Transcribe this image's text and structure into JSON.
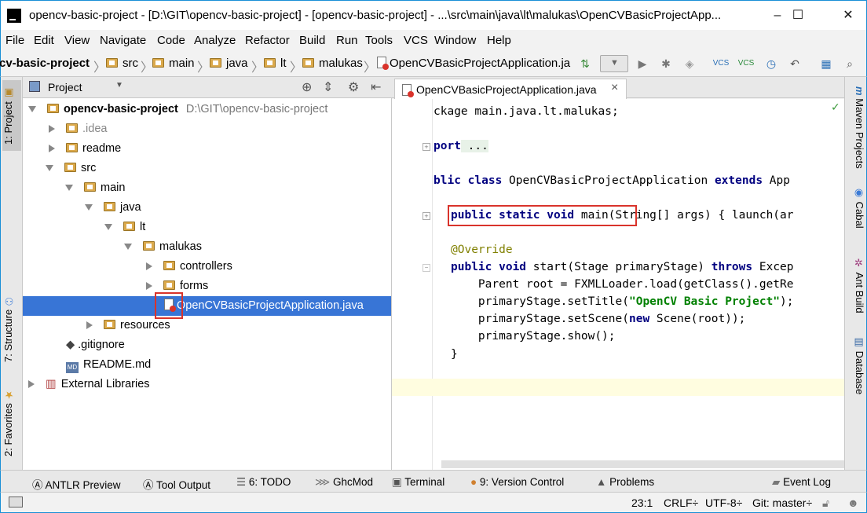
{
  "window": {
    "title": "opencv-basic-project - [D:\\GIT\\opencv-basic-project] - [opencv-basic-project] - ...\\src\\main\\java\\lt\\malukas\\OpenCVBasicProjectApp...",
    "minimize": "–",
    "maximize": "☐",
    "close": "✕"
  },
  "menu": [
    "File",
    "Edit",
    "View",
    "Navigate",
    "Code",
    "Analyze",
    "Refactor",
    "Build",
    "Run",
    "Tools",
    "VCS",
    "Window",
    "Help"
  ],
  "breadcrumb": [
    "cv-basic-project",
    "src",
    "main",
    "java",
    "lt",
    "malukas",
    "OpenCVBasicProjectApplication.ja"
  ],
  "left_tabs": {
    "project": "1: Project",
    "structure": "7: Structure",
    "favorites": "2: Favorites"
  },
  "project_panel": {
    "dropdown": "Project",
    "tree": [
      {
        "label": "opencv-basic-project",
        "path": "D:\\GIT\\opencv-basic-project"
      },
      {
        "label": ".idea"
      },
      {
        "label": "readme"
      },
      {
        "label": "src"
      },
      {
        "label": "main"
      },
      {
        "label": "java"
      },
      {
        "label": "lt"
      },
      {
        "label": "malukas"
      },
      {
        "label": "controllers"
      },
      {
        "label": "forms"
      },
      {
        "label": "OpenCVBasicProjectApplication.java"
      },
      {
        "label": "resources"
      },
      {
        "label": ".gitignore"
      },
      {
        "label": "README.md"
      },
      {
        "label": "External Libraries"
      }
    ]
  },
  "editor": {
    "tab_label": "OpenCVBasicProjectApplication.java",
    "tab_close": "×",
    "lines": {
      "l1": "ckage main.java.lt.malukas;",
      "l2_kw": "port",
      "l2_fold": " ...",
      "l3_kw": "blic class",
      "l3_rest": " OpenCVBasicProjectApplication ",
      "l3_kw2": "extends",
      "l3_end": " App",
      "l4_kw": "public static void",
      "l4_name": " main",
      "l4_rest": "(String[] args) { launch(ar",
      "l5": "@Override",
      "l6_kw": "public void",
      "l6_rest": " start(Stage primaryStage) ",
      "l6_kw2": "throws",
      "l6_end": " Excep",
      "l7": "    Parent root = FXMLLoader.load(getClass().getRe",
      "l8_a": "    primaryStage.setTitle(",
      "l8_str": "\"OpenCV Basic Project\"",
      "l8_b": ");",
      "l9_a": "    primaryStage.setScene(",
      "l9_kw": "new",
      "l9_b": " Scene(root));",
      "l10": "    primaryStage.show();",
      "l11": "}"
    }
  },
  "right_tabs": {
    "maven": "Maven Projects",
    "cabal": "Cabal",
    "ant": "Ant Build",
    "database": "Database"
  },
  "tool_windows": [
    "ANTLR Preview",
    "Tool Output",
    "6: TODO",
    "GhcMod",
    "Terminal",
    "9: Version Control",
    "Problems",
    "Event Log"
  ],
  "status": {
    "position": "23:1",
    "line_sep": "CRLF÷",
    "encoding": "UTF-8÷",
    "git": "Git: master÷"
  }
}
